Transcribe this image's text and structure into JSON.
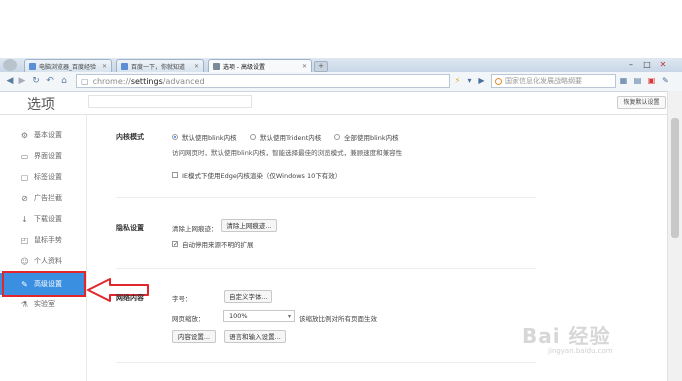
{
  "tabs": [
    {
      "label": "电脑浏览器_百度经验"
    },
    {
      "label": "百度一下，你就知道"
    },
    {
      "label": "选项 - 高级设置"
    }
  ],
  "address_bar": {
    "scheme": "chrome://",
    "host": "settings",
    "path": "/advanced"
  },
  "search_box": {
    "placeholder": "国家信息化发展战略纲要"
  },
  "page": {
    "title": "选项",
    "restore_button": "恢复默认设置"
  },
  "sidebar": {
    "items": [
      {
        "label": "基本设置",
        "icon": "gear-icon"
      },
      {
        "label": "界面设置",
        "icon": "window-icon"
      },
      {
        "label": "标签设置",
        "icon": "tab-icon"
      },
      {
        "label": "广告拦截",
        "icon": "block-icon"
      },
      {
        "label": "下载设置",
        "icon": "download-icon"
      },
      {
        "label": "鼠标手势",
        "icon": "mouse-icon"
      },
      {
        "label": "个人资料",
        "icon": "person-icon"
      },
      {
        "label": "高级设置",
        "icon": "advanced-icon"
      },
      {
        "label": "实验室",
        "icon": "lab-icon"
      }
    ],
    "active_index": 7
  },
  "kernel": {
    "title": "内核模式",
    "options": [
      "默认使用blink内核",
      "默认使用Trident内核",
      "全部使用blink内核"
    ],
    "selected": 0,
    "note": "访问网页时，默认使用blink内核，智能选择最佳的浏览模式，兼顾速度和兼容性",
    "edge_checkbox": "IE模式下使用Edge内核渲染（仅Windows 10下有效）"
  },
  "privacy": {
    "title": "隐私设置",
    "clear_label": "清除上网痕迹：",
    "clear_button": "清除上网痕迹...",
    "extension_checkbox": "自动停用来源不明的扩展"
  },
  "webcontent": {
    "title": "网络内容",
    "font_label": "字号：",
    "font_button": "自定义字体...",
    "zoom_label": "网页缩放：",
    "zoom_value": "100%",
    "zoom_note": "该缩放比例对所有页面生效",
    "content_button": "内容设置...",
    "language_button": "语言和输入设置..."
  },
  "watermark": {
    "text": "Bai 经验",
    "sub": "jingyan.baidu.com"
  },
  "colors": {
    "accent": "#3b8fe1",
    "highlight": "#e2262b"
  }
}
